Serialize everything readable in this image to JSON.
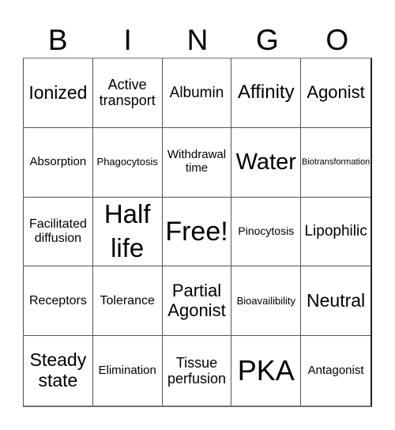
{
  "header": {
    "letters": [
      "B",
      "I",
      "N",
      "G",
      "O"
    ]
  },
  "board": {
    "rows": [
      [
        "Ionized",
        "Active transport",
        "Albumin",
        "Affinity",
        "Agonist"
      ],
      [
        "Absorption",
        "Phagocytosis",
        "Withdrawal time",
        "Water",
        "Biotransformation"
      ],
      [
        "Facilitated diffusion",
        "Half life",
        "Free!",
        "Pinocytosis",
        "Lipophilic"
      ],
      [
        "Receptors",
        "Tolerance",
        "Partial Agonist",
        "Bioavailibility",
        "Neutral"
      ],
      [
        "Steady state",
        "Elimination",
        "Tissue perfusion",
        "PKA",
        "Antagonist"
      ]
    ],
    "free_space": "Free!"
  }
}
